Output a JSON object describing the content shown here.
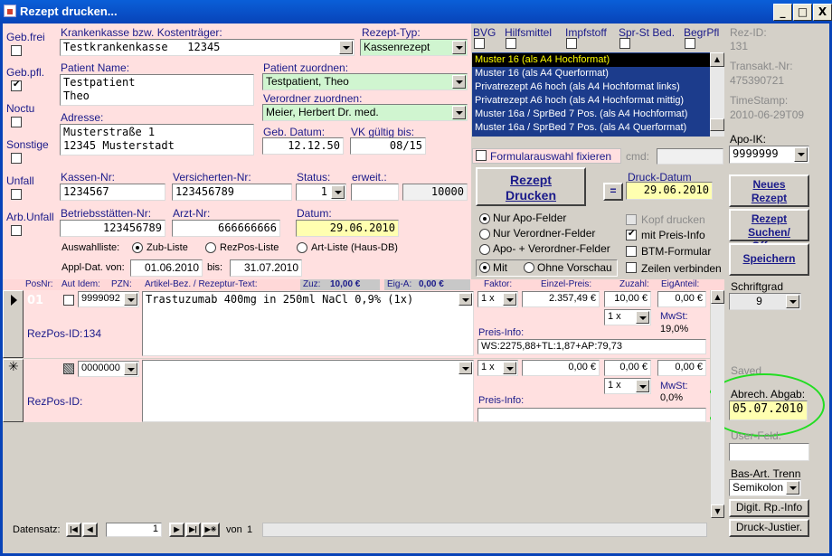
{
  "window": {
    "title": "Rezept drucken...",
    "min": "_",
    "max": "□",
    "close": "X"
  },
  "left": {
    "geb_frei": "Geb.frei",
    "geb_pfl": "Geb.pfl.",
    "noctu": "Noctu",
    "sonstige": "Sonstige",
    "unfall": "Unfall",
    "arb_unfall": "Arb.Unfall"
  },
  "form": {
    "kk_label": "Krankenkasse bzw. Kostenträger:",
    "kk_value": "Testkrankenkasse   12345",
    "rt_label": "Rezept-Typ:",
    "rt_value": "Kassenrezept",
    "pname_label": "Patient Name:",
    "pname_value": "Testpatient\nTheo",
    "pz_label": "Patient zuordnen:",
    "pz_value": "Testpatient, Theo",
    "vz_label": "Verordner zuordnen:",
    "vz_value": "Meier, Herbert Dr. med.",
    "adr_label": "Adresse:",
    "adr_value": "Musterstraße 1\n12345 Musterstadt",
    "geb_label": "Geb. Datum:",
    "geb_value": "12.12.50",
    "vk_label": "VK gültig bis:",
    "vk_value": "08/15",
    "kn_label": "Kassen-Nr:",
    "kn_value": "1234567",
    "vn_label": "Versicherten-Nr:",
    "vn_value": "123456789",
    "st_label": "Status:",
    "st_value": "1",
    "er_label": "erweit.:",
    "er_value": "",
    "er2_value": "10000",
    "bs_label": "Betriebsstätten-Nr:",
    "bs_value": "123456789",
    "az_label": "Arzt-Nr:",
    "az_value": "666666666",
    "dt_label": "Datum:",
    "dt_value": "29.06.2010",
    "al_label": "Auswahlliste:",
    "al_opt1": "Zub-Liste",
    "al_opt2": "RezPos-Liste",
    "al_opt3": "Art-Liste (Haus-DB)",
    "ad_label": "Appl-Dat. von:",
    "ad_from": "01.06.2010",
    "ad_bis": "bis:",
    "ad_to": "31.07.2010"
  },
  "flags": {
    "bvg": "BVG",
    "hilfsmittel": "Hilfsmittel",
    "impfstoff": "Impfstoff",
    "sprst": "Spr-St Bed.",
    "begrpfl": "BegrPfl"
  },
  "formats": [
    "Muster 16 (als A4 Hochformat)",
    "Muster 16 (als A4 Querformat)",
    "Privatrezept A6 hoch (als A4 Hochformat links)",
    "Privatrezept A6 hoch (als A4 Hochformat mittig)",
    "Muster 16a / SprBed 7 Pos. (als A4 Hochformat)",
    "Muster 16a / SprBed 7 Pos. (als A4 Querformat)"
  ],
  "print": {
    "fix_label": "Formularauswahl fixieren",
    "cmd_label": "cmd:",
    "btn_line1": "Rezept",
    "btn_line2": "Drucken",
    "dd_label": "Druck-Datum",
    "eq": "=",
    "dd_value": "29.06.2010",
    "r1": "Nur Apo-Felder",
    "r2": "Nur Verordner-Felder",
    "r3": "Apo- + Verordner-Felder",
    "c1": "Kopf drucken",
    "c2": "mit Preis-Info",
    "c3": "BTM-Formular",
    "c4": "Zeilen verbinden",
    "v1": "Mit",
    "v2": "Ohne Vorschau"
  },
  "right": {
    "rezid_label": "Rez-ID:",
    "rezid_value": "131",
    "tn_label": "Transakt.-Nr:",
    "tn_value": "475390721",
    "ts_label": "TimeStamp:",
    "ts_value": "2010-06-29T09",
    "apoik_label": "Apo-IK:",
    "apoik_value": "9999999",
    "neu1": "Neues",
    "neu2": "Rezept",
    "such1": "Rezept",
    "such2": "Suchen/Öffnen",
    "speichern": "Speichern",
    "sg_label": "Schriftgrad",
    "sg_value": "9",
    "saved": "Saved",
    "ab_label": "Abrech. Abgab:",
    "ab_value": "05.07.2010",
    "uf_label": "User-Feld:",
    "bt_label": "Bas-Art. Trenn",
    "bt_value": "Semikolon",
    "digit": "Digit. Rp.-Info",
    "justier": "Druck-Justier."
  },
  "grid": {
    "h_posnr": "PosNr:",
    "h_autidem": "Aut Idem:",
    "h_pzn": "PZN:",
    "h_artikel": "Artikel-Bez. / Rezeptur-Text:",
    "h_zuz": "Zuz:",
    "h_zuz_v": "10,00 €",
    "h_eiga": "Eig-A:",
    "h_eiga_v": "0,00 €",
    "h_faktor": "Faktor:",
    "h_einzel": "Einzel-Preis:",
    "h_zuzahl": "Zuzahl:",
    "h_eiganteil": "EigAnteil:",
    "row1": {
      "pos": "01",
      "pzn": "9999092",
      "text": "Trastuzumab 400mg in 250ml NaCl 0,9% (1x)",
      "faktor": "1 x",
      "preis": "2.357,49 €",
      "zuz": "10,00 €",
      "eig": "0,00 €",
      "menge": "1 x",
      "rezpos_label": "RezPos-ID:",
      "rezpos_value": "134",
      "mwst_label": "MwSt:",
      "mwst_value": "19,0%",
      "pi_label": "Preis-Info:",
      "pi_value": "WS:2275,88+TL:1,87+AP:79,73"
    },
    "row2": {
      "pzn": "0000000",
      "faktor": "1 x",
      "preis": "0,00 €",
      "zuz": "0,00 €",
      "eig": "0,00 €",
      "menge": "1 x",
      "rezpos_label": "RezPos-ID:",
      "mwst_label": "MwSt:",
      "mwst_value": "0,0%",
      "pi_label": "Preis-Info:"
    }
  },
  "nav": {
    "label": "Datensatz:",
    "value": "1",
    "von": "von",
    "total": "1"
  },
  "colors": {
    "accent": "#0843b8",
    "pink": "#ffe0e0",
    "highlight_circle": "#22dd22"
  }
}
